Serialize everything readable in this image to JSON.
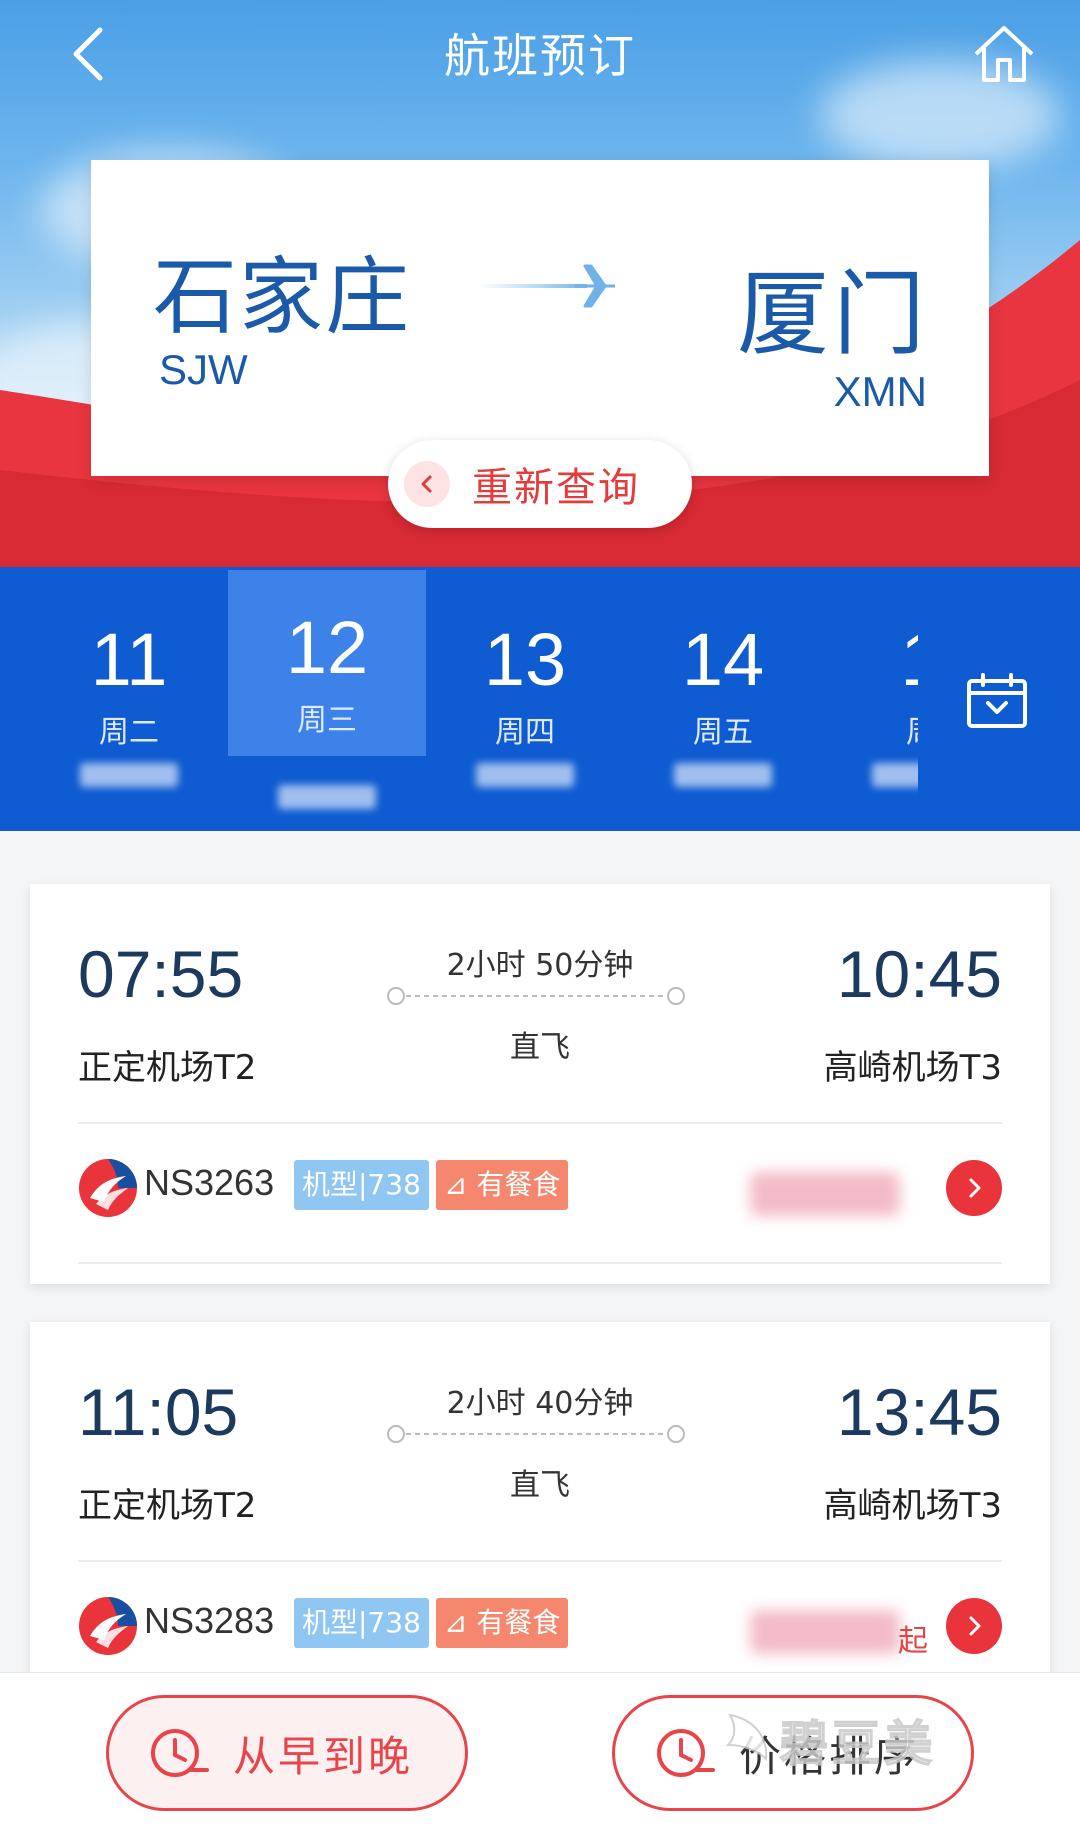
{
  "header": {
    "title": "航班预订"
  },
  "route": {
    "from_city": "石家庄",
    "from_code": "SJW",
    "to_city": "厦门",
    "to_code": "XMN",
    "requery_label": "重新查询"
  },
  "dates": [
    {
      "day": "11",
      "weekday": "周二",
      "selected": false
    },
    {
      "day": "12",
      "weekday": "周三",
      "selected": true
    },
    {
      "day": "13",
      "weekday": "周四",
      "selected": false
    },
    {
      "day": "14",
      "weekday": "周五",
      "selected": false
    },
    {
      "day": "1",
      "weekday": "周",
      "selected": false
    }
  ],
  "flights": [
    {
      "dep_time": "07:55",
      "dep_airport": "正定机场T2",
      "arr_time": "10:45",
      "arr_airport": "高崎机场T3",
      "duration": "2小时 50分钟",
      "stop_type": "直飞",
      "flight_no": "NS3263",
      "aircraft_tag": "机型|738",
      "meal_tag": "有餐食",
      "price_suffix": ""
    },
    {
      "dep_time": "11:05",
      "dep_airport": "正定机场T2",
      "arr_time": "13:45",
      "arr_airport": "高崎机场T3",
      "duration": "2小时 40分钟",
      "stop_type": "直飞",
      "flight_no": "NS3283",
      "aircraft_tag": "机型|738",
      "meal_tag": "有餐食",
      "price_suffix": "起"
    }
  ],
  "bottom": {
    "sort_time_label": "从早到晚",
    "sort_price_label": "价格排序"
  },
  "watermark": {
    "text": "碧豆美"
  },
  "colors": {
    "brand_blue": "#0f5bd1",
    "selected_date": "#3c82e8",
    "accent_red": "#e8343a",
    "city_blue": "#1a5aa8"
  }
}
